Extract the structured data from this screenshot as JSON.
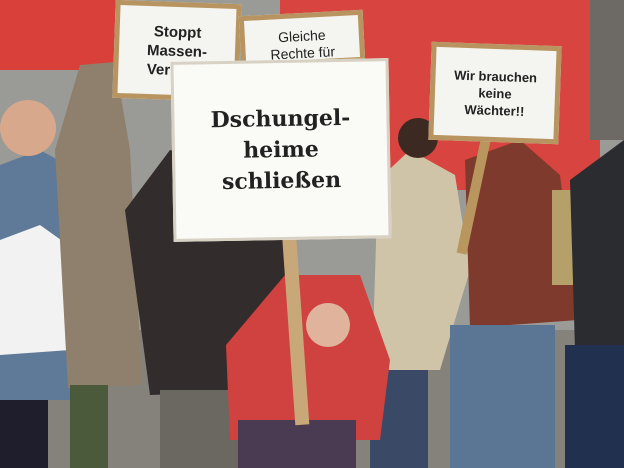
{
  "photo": {
    "description_colors": {
      "banner": "#d83a36",
      "sky": "#9aa0a4",
      "ground": "#8a8781"
    }
  },
  "signs": {
    "main": "Dschungel-\nheime\nschließen",
    "stoppt": "Stoppt\nMassen-\nVerpfleg",
    "gleiche": "Gleiche\nRechte für",
    "waechter": "Wir brauchen\nkeine\nWächter!!"
  }
}
